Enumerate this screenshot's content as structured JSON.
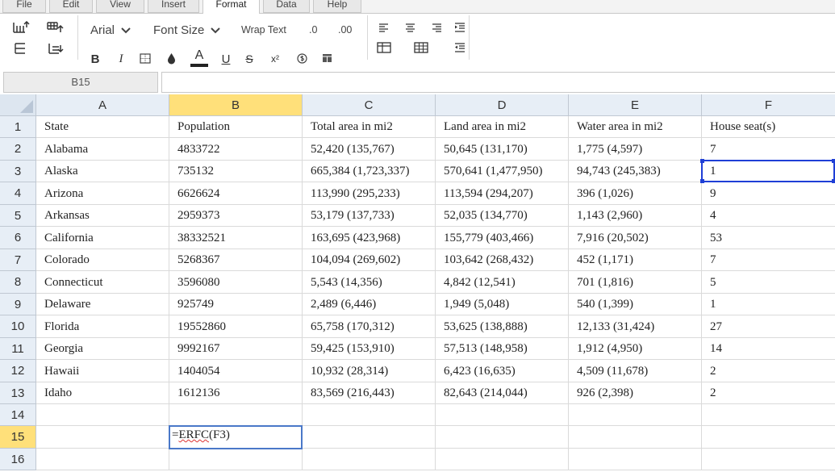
{
  "tabs": [
    "File",
    "Edit",
    "View",
    "Insert",
    "Format",
    "Data",
    "Help"
  ],
  "active_tab": "Format",
  "toolbar": {
    "font_family": "Arial",
    "font_size": "Font Size",
    "wrap_text": "Wrap Text",
    "decrease_decimal": ".0",
    "increase_decimal": ".00",
    "bold": "B",
    "italic": "I",
    "text_color": "A",
    "underline": "U",
    "strike": "S",
    "superscript": "x²"
  },
  "formula_bar": {
    "cell_ref": "B15",
    "content": ""
  },
  "sheet": {
    "columns": [
      "A",
      "B",
      "C",
      "D",
      "E",
      "F"
    ],
    "row_numbers": [
      "1",
      "2",
      "3",
      "4",
      "5",
      "6",
      "7",
      "8",
      "9",
      "10",
      "11",
      "12",
      "13",
      "14",
      "15",
      "16"
    ],
    "selected_column": "B",
    "selected_row": "15",
    "rows": [
      [
        "State",
        "Population",
        "Total area in mi2",
        "Land area in mi2",
        "Water area in mi2",
        "House seat(s)"
      ],
      [
        "Alabama",
        "4833722",
        "52,420 (135,767)",
        "50,645 (131,170)",
        "1,775 (4,597)",
        "7"
      ],
      [
        "Alaska",
        "735132",
        "665,384 (1,723,337)",
        "570,641 (1,477,950)",
        "94,743 (245,383)",
        "1"
      ],
      [
        "Arizona",
        "6626624",
        "113,990 (295,233)",
        "113,594 (294,207)",
        "396 (1,026)",
        "9"
      ],
      [
        "Arkansas",
        "2959373",
        "53,179 (137,733)",
        "52,035 (134,770)",
        "1,143 (2,960)",
        "4"
      ],
      [
        "California",
        "38332521",
        "163,695 (423,968)",
        "155,779 (403,466)",
        "7,916 (20,502)",
        "53"
      ],
      [
        "Colorado",
        "5268367",
        "104,094 (269,602)",
        "103,642 (268,432)",
        "452 (1,171)",
        "7"
      ],
      [
        "Connecticut",
        "3596080",
        "5,543 (14,356)",
        "4,842 (12,541)",
        "701 (1,816)",
        "5"
      ],
      [
        "Delaware",
        "925749",
        "2,489 (6,446)",
        "1,949 (5,048)",
        "540 (1,399)",
        "1"
      ],
      [
        "Florida",
        "19552860",
        "65,758 (170,312)",
        "53,625 (138,888)",
        "12,133 (31,424)",
        "27"
      ],
      [
        "Georgia",
        "9992167",
        "59,425 (153,910)",
        "57,513 (148,958)",
        "1,912 (4,950)",
        "14"
      ],
      [
        "Hawaii",
        "1404054",
        "10,932 (28,314)",
        "6,423 (16,635)",
        "4,509 (11,678)",
        "2"
      ],
      [
        "Idaho",
        "1612136",
        "83,569 (216,443)",
        "82,643 (214,044)",
        "926 (2,398)",
        "2"
      ],
      [
        "",
        "",
        "",
        "",
        "",
        ""
      ],
      [
        "",
        "",
        "",
        "",
        "",
        ""
      ],
      [
        "",
        "",
        "",
        "",
        "",
        ""
      ]
    ],
    "edit_cell": {
      "prefix": "=",
      "function": "ERFC",
      "args": "(F3)"
    }
  }
}
